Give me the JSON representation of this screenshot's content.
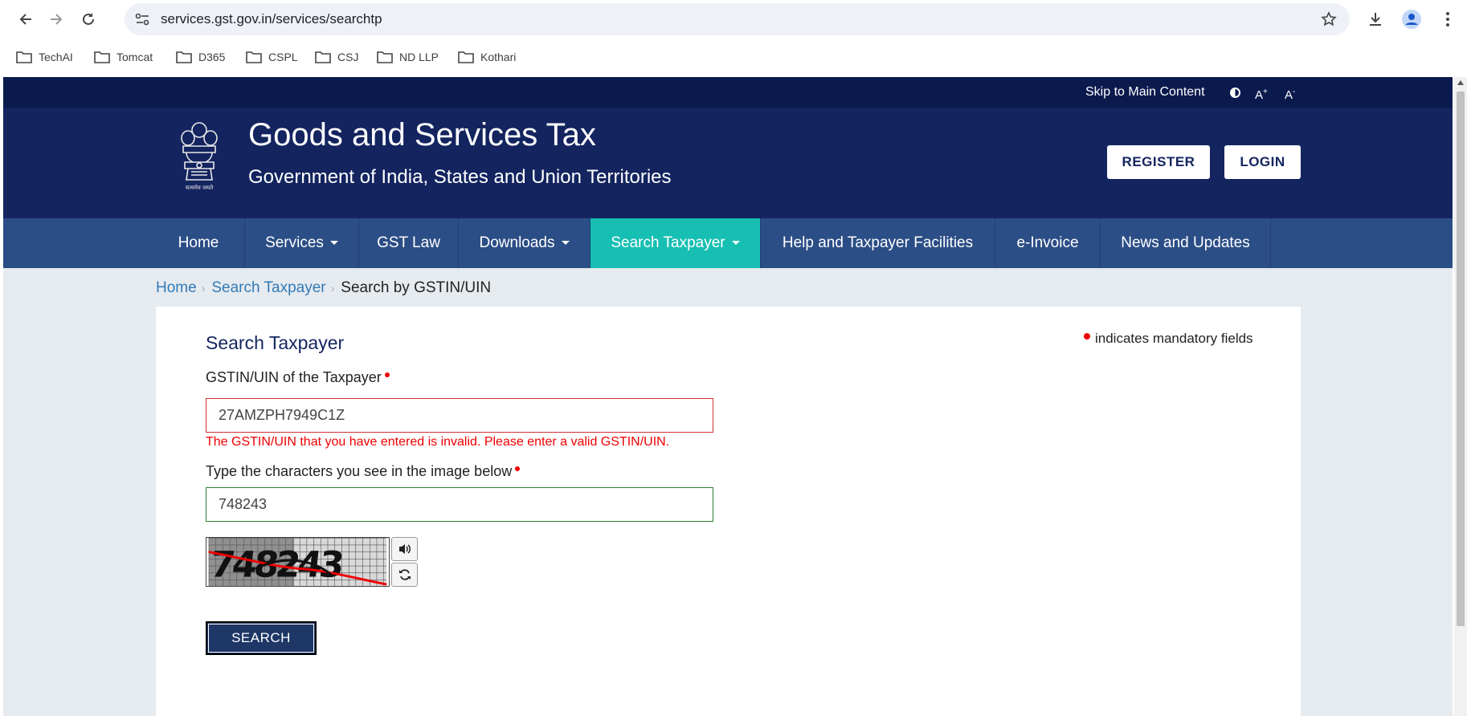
{
  "browser": {
    "url": "services.gst.gov.in/services/searchtp",
    "bookmarks": [
      {
        "label": "TechAI",
        "icon": "folder-icon"
      },
      {
        "label": "Tomcat",
        "icon": "folder-icon"
      },
      {
        "label": "D365",
        "icon": "folder-icon"
      },
      {
        "label": "CSPL",
        "icon": "folder-icon"
      },
      {
        "label": "CSJ",
        "icon": "folder-icon"
      },
      {
        "label": "ND LLP",
        "icon": "folder-icon"
      },
      {
        "label": "Kothari",
        "icon": "folder-icon"
      }
    ]
  },
  "topstrip": {
    "skip": "Skip to Main Content",
    "font_increase": "A",
    "font_increase_sup": "+",
    "font_decrease": "A",
    "font_decrease_sup": "-"
  },
  "header": {
    "emblem_caption": "सत्यमेव जयते",
    "title": "Goods and Services Tax",
    "subtitle": "Government of India, States and Union Territories",
    "register": "REGISTER",
    "login": "LOGIN"
  },
  "nav": {
    "items": [
      {
        "label": "Home"
      },
      {
        "label": "Services"
      },
      {
        "label": "GST Law"
      },
      {
        "label": "Downloads"
      },
      {
        "label": "Search Taxpayer"
      },
      {
        "label": "Help and Taxpayer Facilities"
      },
      {
        "label": "e-Invoice"
      },
      {
        "label": "News and Updates"
      }
    ]
  },
  "breadcrumb": {
    "home": "Home",
    "search_taxpayer": "Search Taxpayer",
    "current": "Search by GSTIN/UIN"
  },
  "form": {
    "title": "Search Taxpayer",
    "mandatory_note": "indicates mandatory fields",
    "gstin_label": "GSTIN/UIN of the Taxpayer",
    "gstin_value": "27AMZPH7949C1Z",
    "gstin_error": "The GSTIN/UIN that you have entered is invalid. Please enter a valid GSTIN/UIN.",
    "captcha_label": "Type the characters you see in the image below",
    "captcha_value": "748243",
    "captcha_image_text": "748243",
    "search_button": "SEARCH"
  },
  "colors": {
    "top_strip": "#0b1a4d",
    "header": "#13245f",
    "nav": "#2c4e86",
    "nav_active": "#17bfb3",
    "error": "#e00000"
  }
}
